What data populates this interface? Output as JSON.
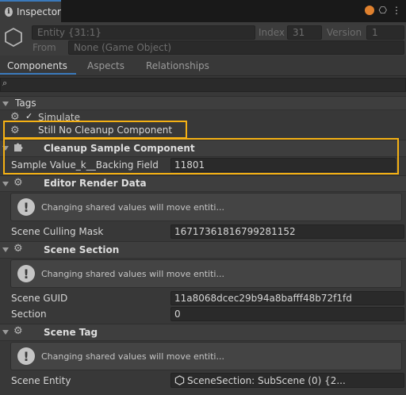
{
  "window": {
    "tab_label": "Inspector",
    "lock_glyph": "⎔",
    "menu_glyph": "⋮"
  },
  "header": {
    "entity_name": "Entity {31:1}",
    "index_label": "Index",
    "index_value": "31",
    "version_label": "Version",
    "version_value": "1",
    "from_label": "From",
    "from_value": "None (Game Object)"
  },
  "tabs": [
    {
      "label": "Components",
      "active": true
    },
    {
      "label": "Aspects",
      "active": false
    },
    {
      "label": "Relationships",
      "active": false
    }
  ],
  "search": {
    "icon": "⌕",
    "placeholder": ""
  },
  "components": {
    "tags": {
      "title": "Tags",
      "simulate": "Simulate",
      "still_no_cleanup": "Still No Cleanup Component"
    },
    "cleanup": {
      "title": "Cleanup Sample Component",
      "field_label": "Sample Value_k__Backing Field",
      "field_value": "11801"
    },
    "render": {
      "title": "Editor Render Data",
      "help": "Changing shared values will move entiti...",
      "mask_label": "Scene Culling Mask",
      "mask_value": "16717361816799281152"
    },
    "section": {
      "title": "Scene Section",
      "help": "Changing shared values will move entiti...",
      "guid_label": "Scene GUID",
      "guid_value": "11a8068dcec29b94a8bafff48b72f1fd",
      "section_label": "Section",
      "section_value": "0"
    },
    "scene_tag": {
      "title": "Scene Tag",
      "help": "Changing shared values will move entiti...",
      "entity_label": "Scene Entity",
      "entity_value": "SceneSection: SubScene (0) {2..."
    }
  },
  "colors": {
    "highlight": "#f5b114",
    "accent": "#3a79bb",
    "status_dot": "#e0812e"
  }
}
